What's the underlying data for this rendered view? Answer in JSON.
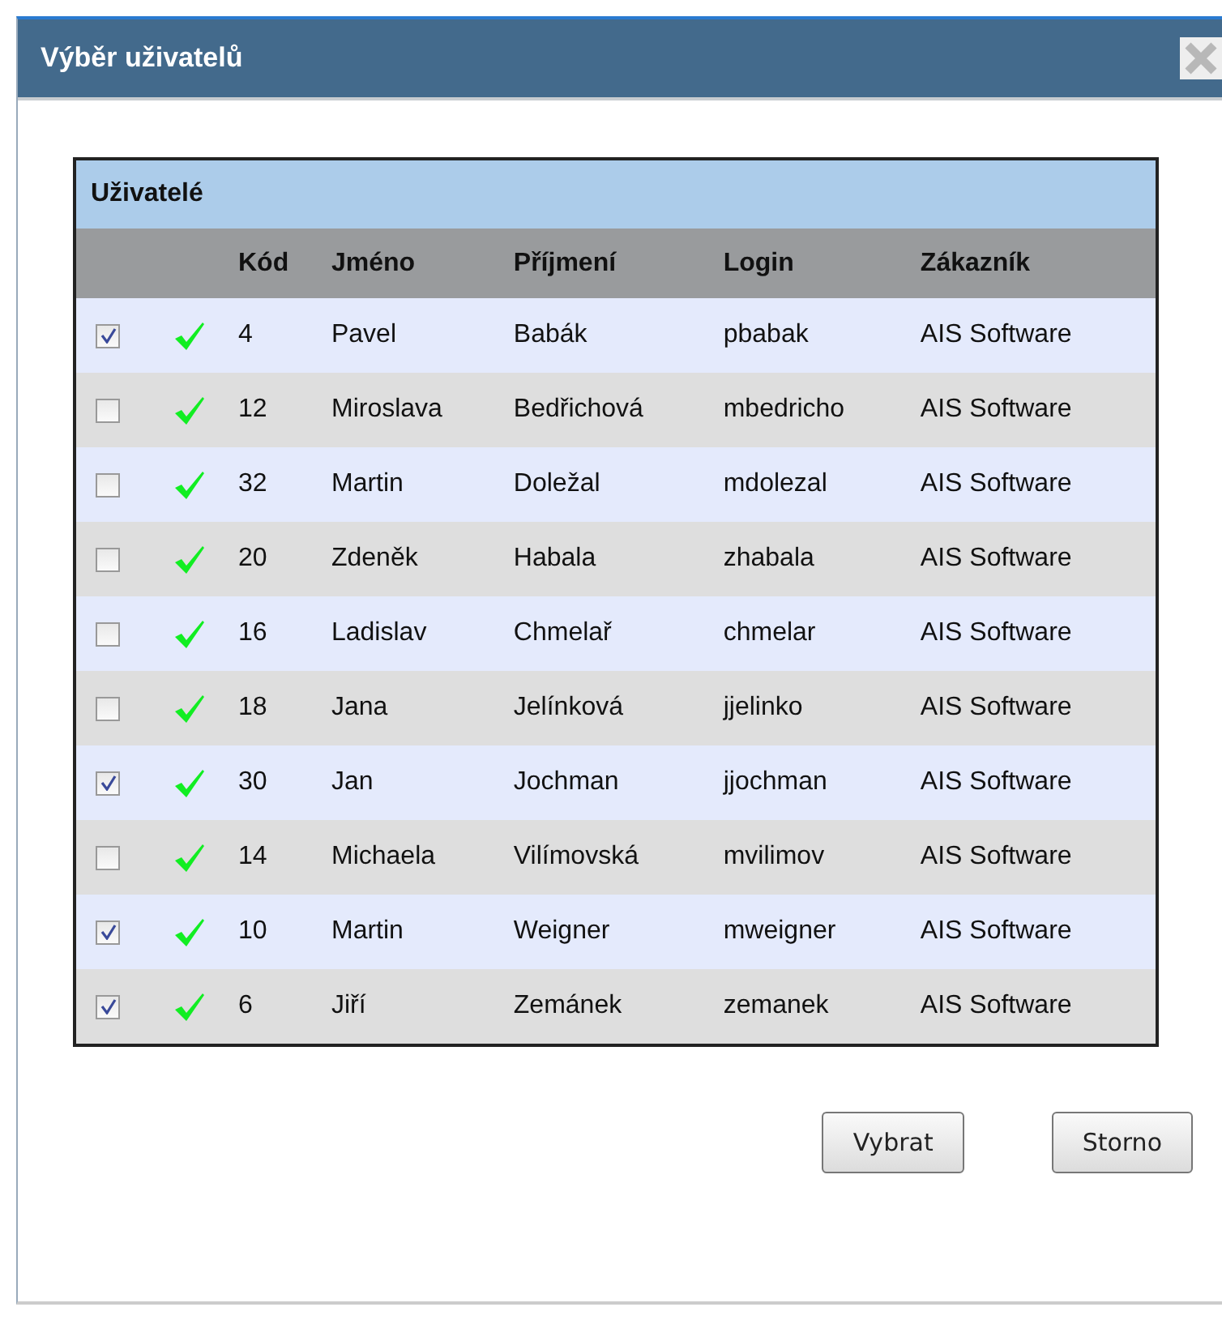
{
  "window": {
    "title": "Výběr uživatelů"
  },
  "table": {
    "caption": "Uživatelé",
    "columns": [
      "Kód",
      "Jméno",
      "Příjmení",
      "Login",
      "Zákazník"
    ],
    "rows": [
      {
        "checked": true,
        "active": true,
        "cells": [
          "4",
          "Pavel",
          "Babák",
          "pbabak",
          "AIS Software"
        ]
      },
      {
        "checked": false,
        "active": true,
        "cells": [
          "12",
          "Miroslava",
          "Bedřichová",
          "mbedricho",
          "AIS Software"
        ]
      },
      {
        "checked": false,
        "active": true,
        "cells": [
          "32",
          "Martin",
          "Doležal",
          "mdolezal",
          "AIS Software"
        ]
      },
      {
        "checked": false,
        "active": true,
        "cells": [
          "20",
          "Zdeněk",
          "Habala",
          "zhabala",
          "AIS Software"
        ]
      },
      {
        "checked": false,
        "active": true,
        "cells": [
          "16",
          "Ladislav",
          "Chmelař",
          "chmelar",
          "AIS Software"
        ]
      },
      {
        "checked": false,
        "active": true,
        "cells": [
          "18",
          "Jana",
          "Jelínková",
          "jjelinko",
          "AIS Software"
        ]
      },
      {
        "checked": true,
        "active": true,
        "cells": [
          "30",
          "Jan",
          "Jochman",
          "jjochman",
          "AIS Software"
        ]
      },
      {
        "checked": false,
        "active": true,
        "cells": [
          "14",
          "Michaela",
          "Vilímovská",
          "mvilimov",
          "AIS Software"
        ]
      },
      {
        "checked": true,
        "active": true,
        "cells": [
          "10",
          "Martin",
          "Weigner",
          "mweigner",
          "AIS Software"
        ]
      },
      {
        "checked": true,
        "active": true,
        "cells": [
          "6",
          "Jiří",
          "Zemánek",
          "zemanek",
          "AIS Software"
        ]
      }
    ]
  },
  "buttons": [
    "Vybrat",
    "Storno"
  ]
}
